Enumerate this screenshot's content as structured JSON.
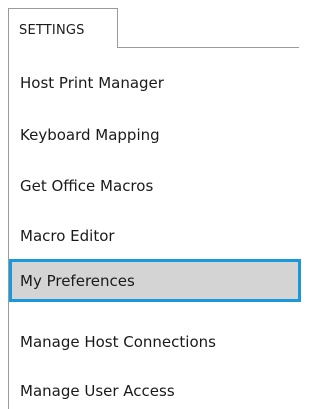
{
  "tab": {
    "label": "SETTINGS"
  },
  "menu": {
    "items": [
      {
        "label": "Host Print Manager",
        "selected": false
      },
      {
        "label": "Keyboard Mapping",
        "selected": false
      },
      {
        "label": "Get Office Macros",
        "selected": false
      },
      {
        "label": "Macro Editor",
        "selected": false
      },
      {
        "label": "My Preferences",
        "selected": true
      },
      {
        "label": "Manage Host Connections",
        "selected": false
      },
      {
        "label": "Manage User Access",
        "selected": false
      }
    ]
  },
  "colors": {
    "selection_border": "#1a98dc",
    "selection_fill": "#d4d4d4",
    "frame_border": "#9a9a9a"
  }
}
